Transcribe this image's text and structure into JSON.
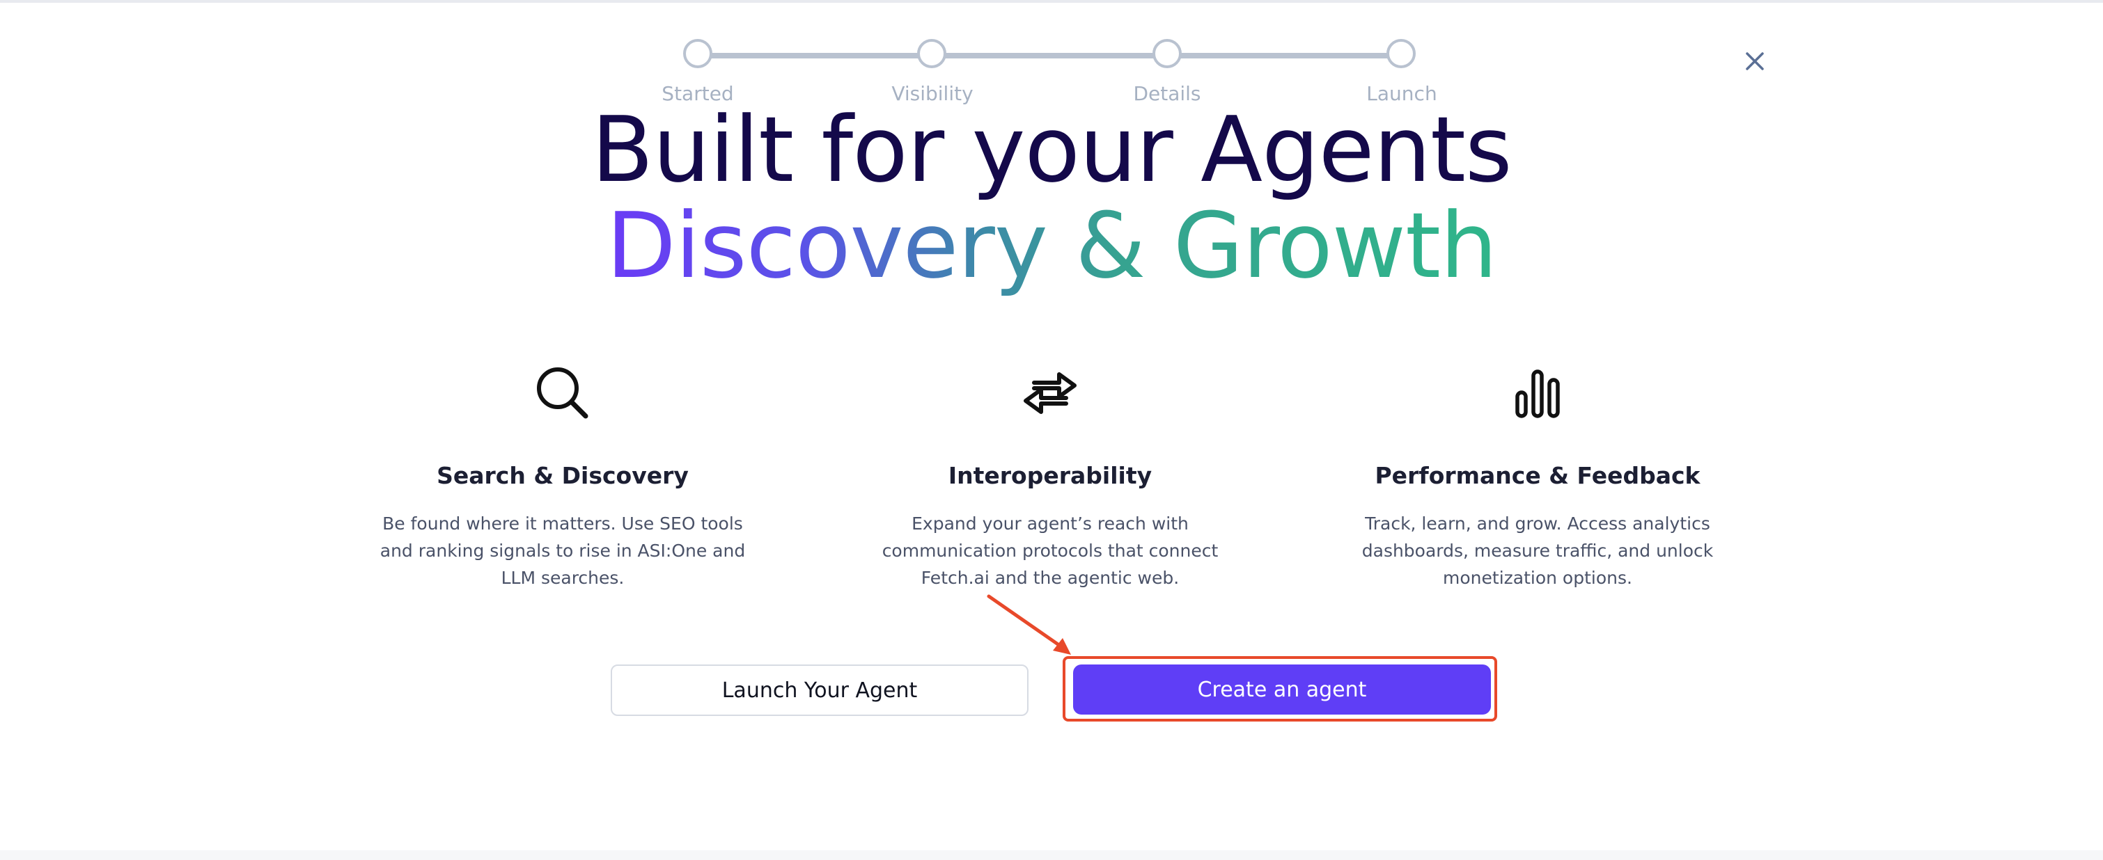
{
  "stepper": {
    "steps": [
      {
        "label": "Started"
      },
      {
        "label": "Visibility"
      },
      {
        "label": "Details"
      },
      {
        "label": "Launch"
      }
    ]
  },
  "hero": {
    "line1": "Built for your Agents",
    "line2": "Discovery & Growth"
  },
  "features": [
    {
      "icon": "search-icon",
      "title": "Search & Discovery",
      "description": "Be found where it matters. Use SEO tools and ranking signals to rise in ASI:One and LLM searches."
    },
    {
      "icon": "exchange-arrows-icon",
      "title": "Interoperability",
      "description": "Expand your agent’s reach with communication protocols that connect Fetch.ai and the agentic web."
    },
    {
      "icon": "bar-chart-icon",
      "title": "Performance & Feedback",
      "description": "Track, learn, and grow. Access analytics dashboards, measure traffic, and unlock monetization options."
    }
  ],
  "buttons": {
    "launch_label": "Launch Your Agent",
    "create_label": "Create an agent"
  },
  "colors": {
    "heading": "#14094a",
    "primary": "#5f3ef6",
    "annotation": "#e8492a",
    "stepper": "#b9c2d0"
  }
}
